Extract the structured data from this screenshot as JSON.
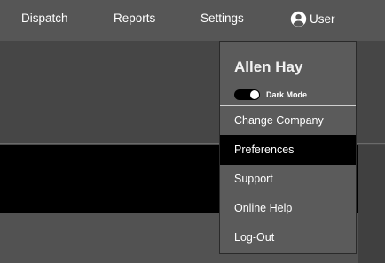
{
  "nav": {
    "dispatch": "Dispatch",
    "reports": "Reports",
    "settings": "Settings",
    "user_label": "User",
    "user_icon": "account-circle-icon"
  },
  "user_menu": {
    "name": "Allen Hay",
    "dark_mode": {
      "label": "Dark Mode",
      "enabled": true
    },
    "items": [
      {
        "label": "Change Company",
        "active": false
      },
      {
        "label": "Preferences",
        "active": true
      },
      {
        "label": "Support",
        "active": false
      },
      {
        "label": "Online Help",
        "active": false
      },
      {
        "label": "Log-Out",
        "active": false
      }
    ]
  },
  "colors": {
    "topbar": "#565656",
    "menu_bg": "#5b5b5b",
    "menu_active": "#000000"
  }
}
